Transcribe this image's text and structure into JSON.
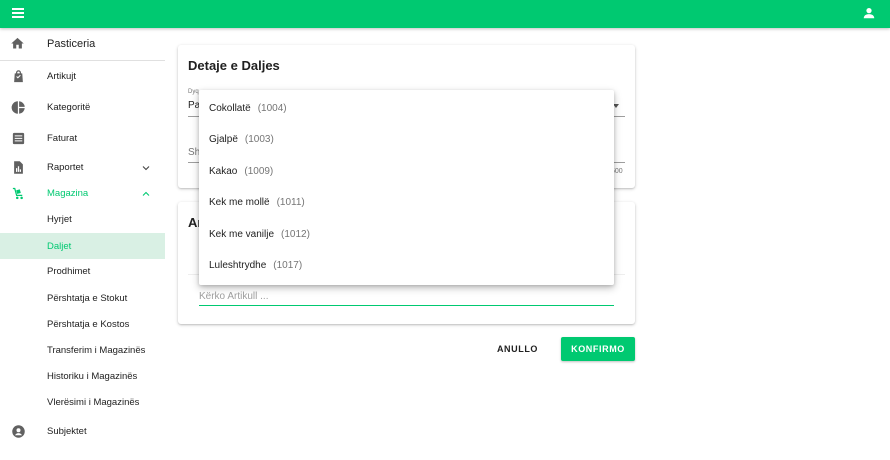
{
  "topbar": {
    "menu_icon": "menu-icon",
    "user_icon": "account-icon",
    "color": "#00c971"
  },
  "sidebar": {
    "title": "Pasticeria",
    "items": [
      {
        "label": "Artikujt",
        "icon": "shopping-bag-icon"
      },
      {
        "label": "Kategoritë",
        "icon": "pie-chart-icon"
      },
      {
        "label": "Faturat",
        "icon": "list-icon"
      },
      {
        "label": "Raportet",
        "icon": "report-icon"
      },
      {
        "label": "Magazina",
        "icon": "warehouse-icon"
      }
    ],
    "subitems": [
      {
        "label": "Hyrjet"
      },
      {
        "label": "Daljet"
      },
      {
        "label": "Prodhimet"
      },
      {
        "label": "Përshtatja e Stokut"
      },
      {
        "label": "Përshtatja e Kostos"
      },
      {
        "label": "Transferim i Magazinës"
      },
      {
        "label": "Historiku i Magazinës"
      },
      {
        "label": "Vlerësimi i Magazinës"
      }
    ],
    "bottom": {
      "label": "Subjektet",
      "icon": "account-circle-icon"
    }
  },
  "details_card": {
    "title": "Detaje e Daljes",
    "warehouse_label_partial": "Dyq",
    "warehouse_value_partial": "Pa",
    "notes_label_partial": "Sh",
    "counter_partial": "500"
  },
  "articles_card": {
    "title_partial": "Ar",
    "search_placeholder": "Kërko Artikull ..."
  },
  "dropdown": {
    "options": [
      {
        "name": "Cokollatë",
        "code": "(1004)"
      },
      {
        "name": "Gjalpë",
        "code": "(1003)"
      },
      {
        "name": "Kakao",
        "code": "(1009)"
      },
      {
        "name": "Kek me mollë",
        "code": "(1011)"
      },
      {
        "name": "Kek me vanilje",
        "code": "(1012)"
      },
      {
        "name": "Luleshtrydhe",
        "code": "(1017)"
      }
    ]
  },
  "actions": {
    "cancel": "ANULLO",
    "confirm": "KONFIRMO"
  }
}
